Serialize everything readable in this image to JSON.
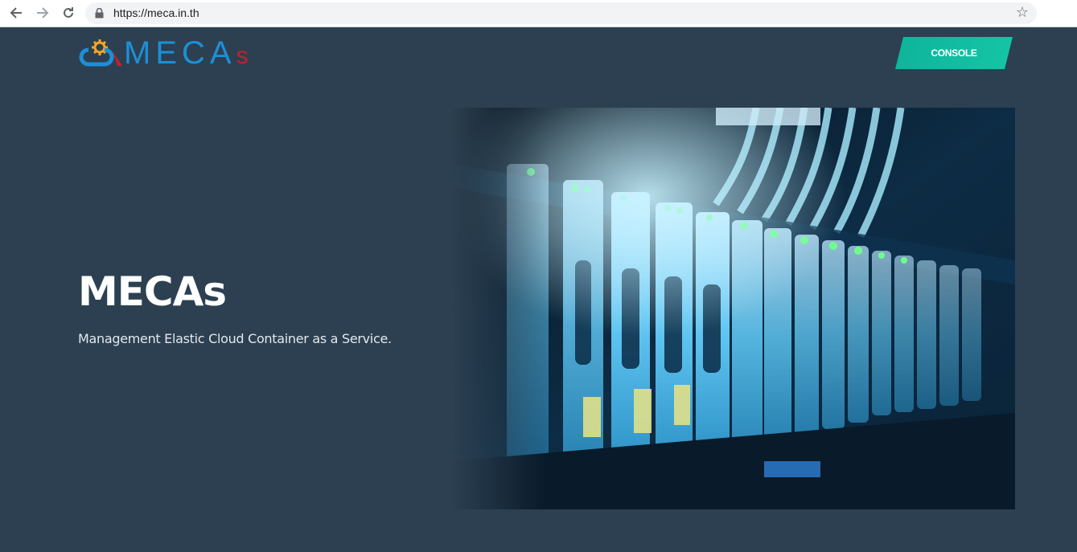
{
  "browser": {
    "url": "https://meca.in.th",
    "back_icon": "arrow-left-icon",
    "forward_icon": "arrow-right-icon",
    "reload_icon": "reload-icon",
    "lock_icon": "lock-icon",
    "bookmark_icon": "star-icon"
  },
  "header": {
    "logo_text": "MECA",
    "logo_suffix": "s",
    "console_label": "CONSOLE"
  },
  "hero": {
    "title": "MECAs",
    "subtitle": "Management Elastic Cloud Container as a Service.",
    "image_alt": "server-rack-image"
  },
  "colors": {
    "background": "#2c4051",
    "accent": "#14c4a5",
    "logo_blue": "#1d8fd6",
    "logo_red": "#c6202b"
  }
}
